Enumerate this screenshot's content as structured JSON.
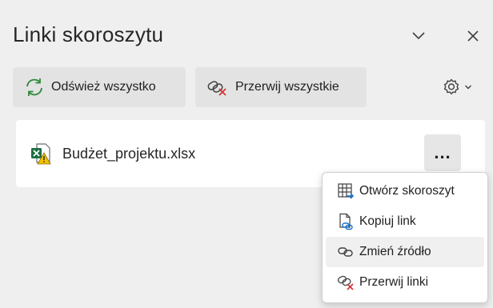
{
  "pane": {
    "title": "Linki skoroszytu",
    "collapse_icon": "chevron-down-icon",
    "close_icon": "close-icon"
  },
  "toolbar": {
    "refresh_all_label": "Odśwież wszystko",
    "break_all_label": "Przerwij wszystkie",
    "settings_icon": "gear-icon"
  },
  "link_card": {
    "file_name": "Budżet_projektu.xlsx",
    "file_icon": "excel-file-warning-icon",
    "more_label": "..."
  },
  "context_menu": {
    "items": [
      {
        "label": "Otwórz skoroszyt",
        "icon": "open-workbook-icon"
      },
      {
        "label": "Kopiuj link",
        "icon": "copy-link-icon"
      },
      {
        "label": "Zmień źródło",
        "icon": "change-source-icon"
      },
      {
        "label": "Przerwij linki",
        "icon": "break-link-icon"
      }
    ]
  },
  "colors": {
    "pane_bg": "#efefef",
    "card_bg": "#ffffff",
    "refresh_green": "#2e8b3a",
    "break_red": "#d13438",
    "link_blue": "#1a73c8",
    "excel_green": "#1d6f42",
    "warning_yellow": "#f2c200"
  }
}
